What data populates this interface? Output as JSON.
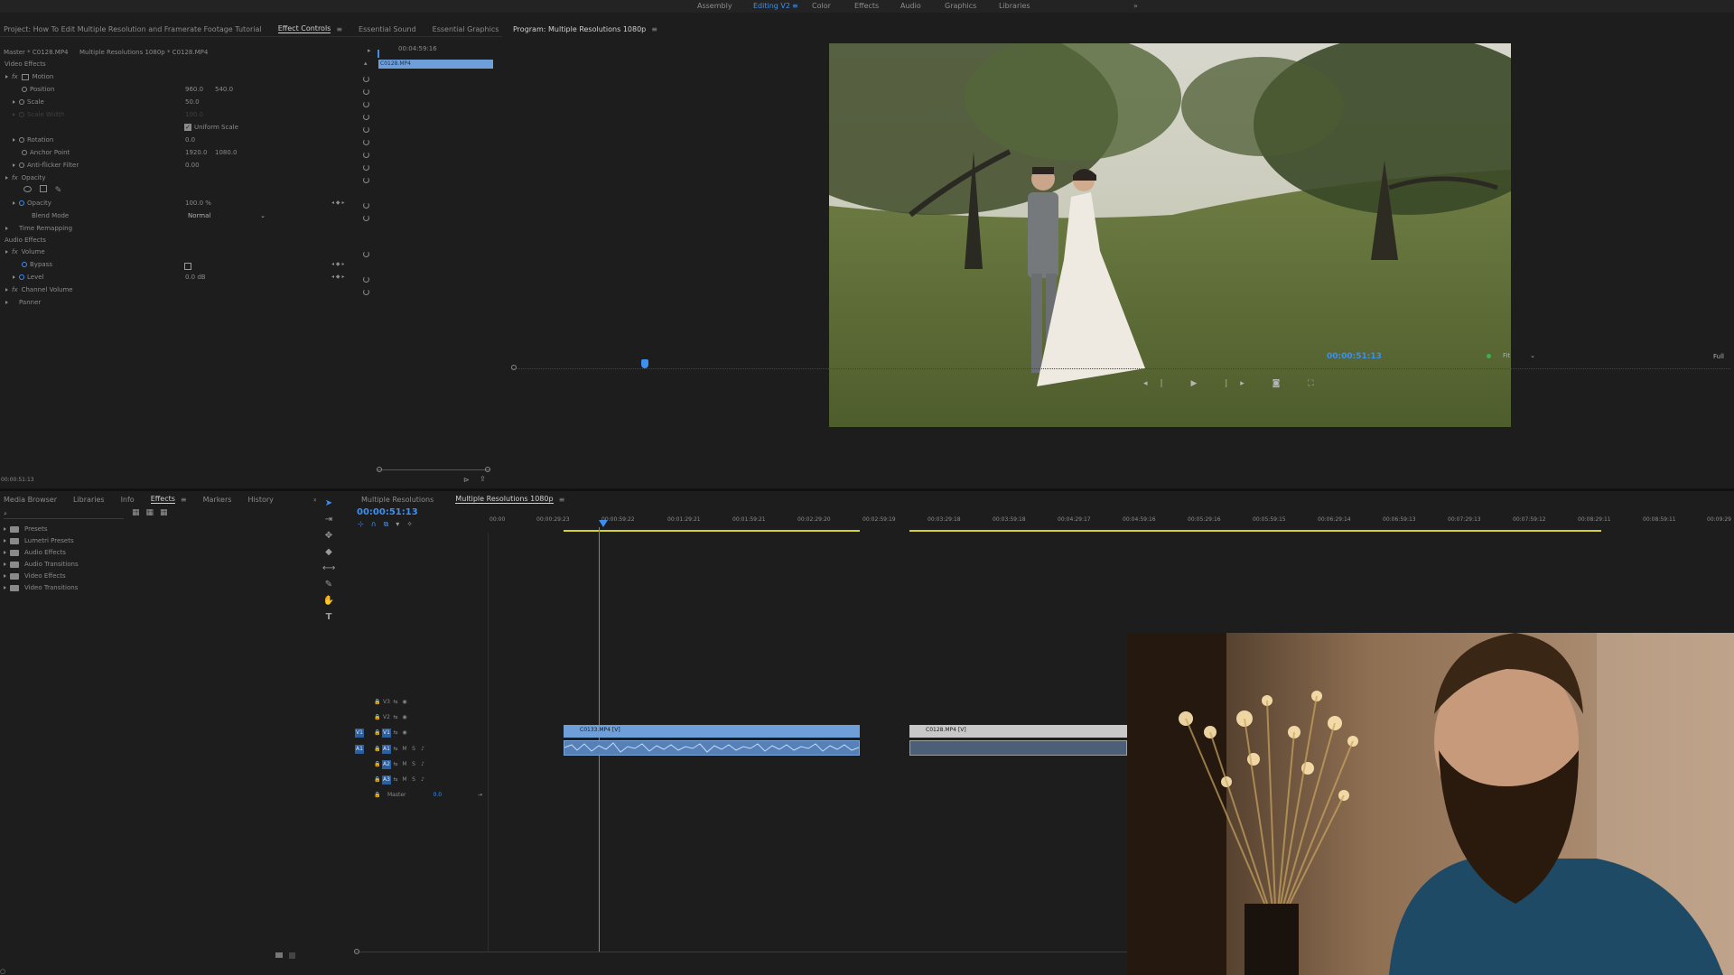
{
  "workspaces": [
    "Assembly",
    "Editing V2",
    "Color",
    "Effects",
    "Audio",
    "Graphics",
    "Libraries"
  ],
  "workspace_active": "Editing V2",
  "source_panel": {
    "project_label": "Project: How To Edit Multiple Resolution and Framerate Footage Tutorial",
    "tabs": [
      "Effect Controls",
      "Essential Sound",
      "Essential Graphics"
    ],
    "active_tab": "Effect Controls",
    "master_label": "Master * C0128.MP4",
    "sequence_label": "Multiple Resolutions 1080p * C0128.MP4",
    "mini_timecode": "00:04:59:16",
    "mini_clip": "C0128.MP4",
    "video_effects_label": "Video Effects",
    "motion_label": "Motion",
    "position_label": "Position",
    "position_x": "960.0",
    "position_y": "540.0",
    "scale_label": "Scale",
    "scale_value": "50.0",
    "scale_width_label": "Scale Width",
    "scale_width_value": "100.0",
    "uniform_scale_label": "Uniform Scale",
    "rotation_label": "Rotation",
    "rotation_value": "0.0",
    "anchor_label": "Anchor Point",
    "anchor_x": "1920.0",
    "anchor_y": "1080.0",
    "antiflicker_label": "Anti-flicker Filter",
    "antiflicker_value": "0.00",
    "opacity_group_label": "Opacity",
    "opacity_label": "Opacity",
    "opacity_value": "100.0 %",
    "blend_mode_label": "Blend Mode",
    "blend_mode_value": "Normal",
    "time_remap_label": "Time Remapping",
    "audio_effects_label": "Audio Effects",
    "volume_label": "Volume",
    "bypass_label": "Bypass",
    "level_label": "Level",
    "level_value": "0.0 dB",
    "channel_volume_label": "Channel Volume",
    "panner_label": "Panner",
    "bottom_timecode": "00:00:51:13"
  },
  "program": {
    "title": "Program: Multiple Resolutions 1080p",
    "timecode": "00:00:51:13",
    "fit": "Fit",
    "quality": "Full"
  },
  "project_panel": {
    "tabs": [
      "Media Browser",
      "Libraries",
      "Info",
      "Effects",
      "Markers",
      "History"
    ],
    "active_tab": "Effects",
    "folders": [
      "Presets",
      "Lumetri Presets",
      "Audio Effects",
      "Audio Transitions",
      "Video Effects",
      "Video Transitions"
    ]
  },
  "timeline": {
    "tabs": [
      "Multiple Resolutions",
      "Multiple Resolutions 1080p"
    ],
    "active_tab": "Multiple Resolutions 1080p",
    "timecode": "00:00:51:13",
    "ruler": [
      "00:00",
      "00:00:29:23",
      "00:00:59:22",
      "00:01:29:21",
      "00:01:59:21",
      "00:02:29:20",
      "00:02:59:19",
      "00:03:29:18",
      "00:03:59:18",
      "00:04:29:17",
      "00:04:59:16",
      "00:05:29:16",
      "00:05:59:15",
      "00:06:29:14",
      "00:06:59:13",
      "00:07:29:13",
      "00:07:59:12",
      "00:08:29:11",
      "00:08:59:11",
      "00:09:29"
    ],
    "tracks": [
      "V3",
      "V2",
      "V1",
      "A1",
      "A2",
      "A3"
    ],
    "master_label": "Master",
    "master_value": "0.0",
    "clip1_label": "C0133.MP4 [V]",
    "clip2_label": "C0128.MP4 [V]"
  },
  "colors": {
    "accent": "#3d8ff0",
    "clip_blue": "#6e9fd8",
    "clip_gray": "#c8c8c8",
    "work_area": "#d4d03a"
  }
}
